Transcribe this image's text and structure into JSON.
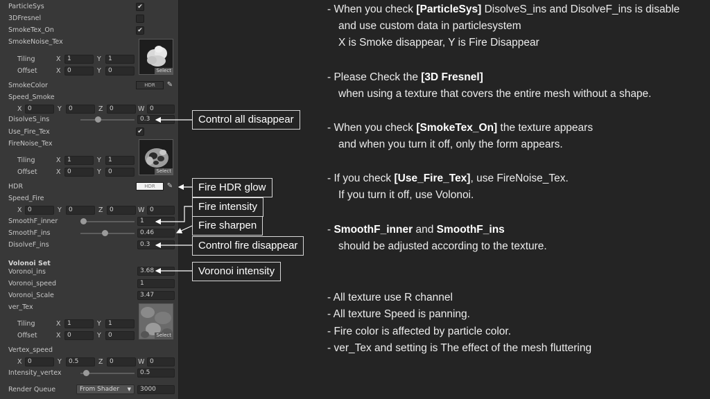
{
  "inspector": {
    "particle_sys": "ParticleSys",
    "fresnel_3d": "3DFresnel",
    "smoketex_on": "SmokeTex_On",
    "smoke_noise_tex": "SmokeNoise_Tex",
    "tiling": "Tiling",
    "offset": "Offset",
    "select": "Select",
    "smoke_color": "SmokeColor",
    "hdr_badge": "HDR",
    "speed_smoke": "Speed_Smoke",
    "disolves_ins": "DisolveS_ins",
    "use_fire_tex": "Use_Fire_Tex",
    "fire_noise_tex": "FireNoise_Tex",
    "hdr_label": "HDR",
    "speed_fire": "Speed_Fire",
    "smoothf_inner": "SmoothF_inner",
    "smoothf_ins": "SmoothF_ins",
    "disolvef_ins": "DisolveF_ins",
    "volonoi_set": "Volonoi Set",
    "voronoi_ins": "Voronoi_ins",
    "voronoi_speed": "Voronoi_speed",
    "voronoi_scale": "Voronoi_Scale",
    "ver_tex": "ver_Tex",
    "vertex_speed": "Vertex_speed",
    "intensity_vertex": "Intensity_vertex",
    "render_queue": "Render Queue",
    "axis_x": "X",
    "axis_y": "Y",
    "axis_z": "Z",
    "axis_w": "W",
    "check": "✔",
    "values": {
      "smoke_tiling_x": "1",
      "smoke_tiling_y": "1",
      "smoke_offset_x": "0",
      "smoke_offset_y": "0",
      "speed_smoke_x": "0",
      "speed_smoke_y": "0",
      "speed_smoke_z": "0",
      "speed_smoke_w": "0",
      "disolves_ins": "0.3",
      "fire_tiling_x": "1",
      "fire_tiling_y": "1",
      "fire_offset_x": "0",
      "fire_offset_y": "0",
      "speed_fire_x": "0",
      "speed_fire_y": "0",
      "speed_fire_z": "0",
      "speed_fire_w": "0",
      "smoothf_inner": "1",
      "smoothf_ins": "0.46",
      "disolvef_ins": "0.3",
      "voronoi_ins": "3.68",
      "voronoi_speed": "1",
      "voronoi_scale": "3.47",
      "ver_tiling_x": "1",
      "ver_tiling_y": "1",
      "ver_offset_x": "0",
      "ver_offset_y": "0",
      "vertex_speed_x": "0",
      "vertex_speed_y": "0.5",
      "vertex_speed_z": "0",
      "vertex_speed_w": "0",
      "intensity_vertex": "0.5",
      "render_queue_mode": "From Shader",
      "render_queue_value": "3000"
    },
    "sliders": {
      "disolves_ins": 0.3,
      "smoothf_inner": 1,
      "smoothf_ins": 0.46,
      "intensity_vertex": 0.5
    },
    "checked": {
      "particle_sys": true,
      "fresnel_3d": false,
      "smoketex_on": true,
      "use_fire_tex": true
    }
  },
  "callouts": {
    "control_all": "Control all disappear",
    "fire_hdr": "Fire HDR glow",
    "fire_intensity": "Fire intensity",
    "fire_sharpen": "Fire sharpen",
    "control_fire": "Control fire disappear",
    "voronoi_intensity": "Voronoi intensity"
  },
  "notes": {
    "n1_a": "- When you check ",
    "n1_b": "[ParticleSys]",
    "n1_c": " DisolveS_ins and DisolveF_ins is disable",
    "n1_d": "and use custom data in particlesystem",
    "n1_e": "X is Smoke disappear, Y is Fire Disappear",
    "n2_a": "- Please Check the ",
    "n2_b": "[3D Fresnel]",
    "n2_c": "when using a texture that covers the entire mesh without a shape.",
    "n3_a": "- When you check ",
    "n3_b": "[SmokeTex_On]",
    "n3_c": " the texture appears",
    "n3_d": "and when you turn it off, only the form appears.",
    "n4_a": "- If you check ",
    "n4_b": "[Use_Fire_Tex]",
    "n4_c": ", use FireNoise_Tex.",
    "n4_d": "If you turn it off, use Volonoi.",
    "n5_a": "- ",
    "n5_b": "SmoothF_inner",
    "n5_c": " and ",
    "n5_d": "SmoothF_ins",
    "n5_e": "should be adjusted according to the texture.",
    "n6": "- All texture use R channel",
    "n7": "- All texture Speed is panning.",
    "n8": "- Fire color is affected by particle color.",
    "n9": "- ver_Tex and setting is The effect of the mesh fluttering"
  },
  "colors": {
    "background": "#242424",
    "panel": "#383838",
    "field": "#2a2a2a",
    "callout_border": "#d9d9d9",
    "text": "#ececec"
  }
}
